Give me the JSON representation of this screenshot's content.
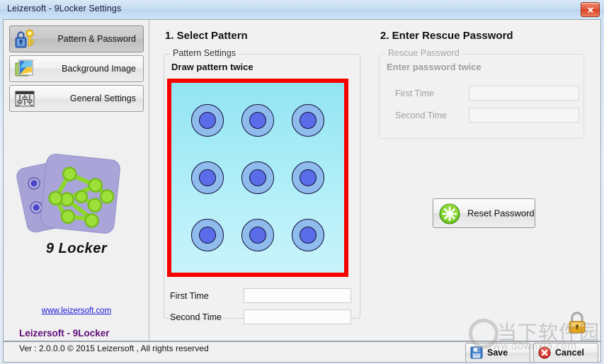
{
  "window": {
    "title": "Leizersoft - 9Locker Settings",
    "close_icon": "close-icon"
  },
  "sidebar": {
    "items": [
      {
        "label": "Pattern & Password",
        "icon": "lock-key-icon",
        "active": true
      },
      {
        "label": "Background Image",
        "icon": "image-icon",
        "active": false
      },
      {
        "label": "General Settings",
        "icon": "sliders-icon",
        "active": false
      }
    ],
    "brand": "9 Locker",
    "link": "www.leizersoft.com"
  },
  "pattern_section": {
    "step_title": "1. Select Pattern",
    "group_title": "Pattern Settings",
    "instruction": "Draw pattern twice",
    "dots": [
      {
        "row": 1,
        "col": 1
      },
      {
        "row": 1,
        "col": 2
      },
      {
        "row": 1,
        "col": 3
      },
      {
        "row": 2,
        "col": 1
      },
      {
        "row": 2,
        "col": 2
      },
      {
        "row": 2,
        "col": 3
      },
      {
        "row": 3,
        "col": 1
      },
      {
        "row": 3,
        "col": 2
      },
      {
        "row": 3,
        "col": 3
      }
    ],
    "first_time_label": "First Time",
    "first_time_value": "",
    "second_time_label": "Second Time",
    "second_time_value": "",
    "border_color": "#f60000",
    "canvas_color": "#aeeef8"
  },
  "rescue_section": {
    "step_title": "2. Enter Rescue Password",
    "group_title": "Rescue Password",
    "instruction": "Enter password twice",
    "first_time_label": "First Time",
    "first_time_value": "",
    "second_time_label": "Second Time",
    "second_time_value": "",
    "reset_button_label": "Reset Password",
    "reset_button_icon": "green-burst-icon",
    "padlock_icon": "padlock-icon"
  },
  "footer": {
    "brand": "Leizersoft - 9Locker",
    "version_line": "Ver : 2.0.0.0   © 2015 Leizersoft , All rights reserved",
    "save_label": "Save",
    "save_icon": "floppy-disk-icon",
    "cancel_label": "Cancel",
    "cancel_icon": "red-x-icon"
  },
  "watermark": {
    "cn_text": "当下软件园",
    "url_text": "www.downxia.com"
  }
}
